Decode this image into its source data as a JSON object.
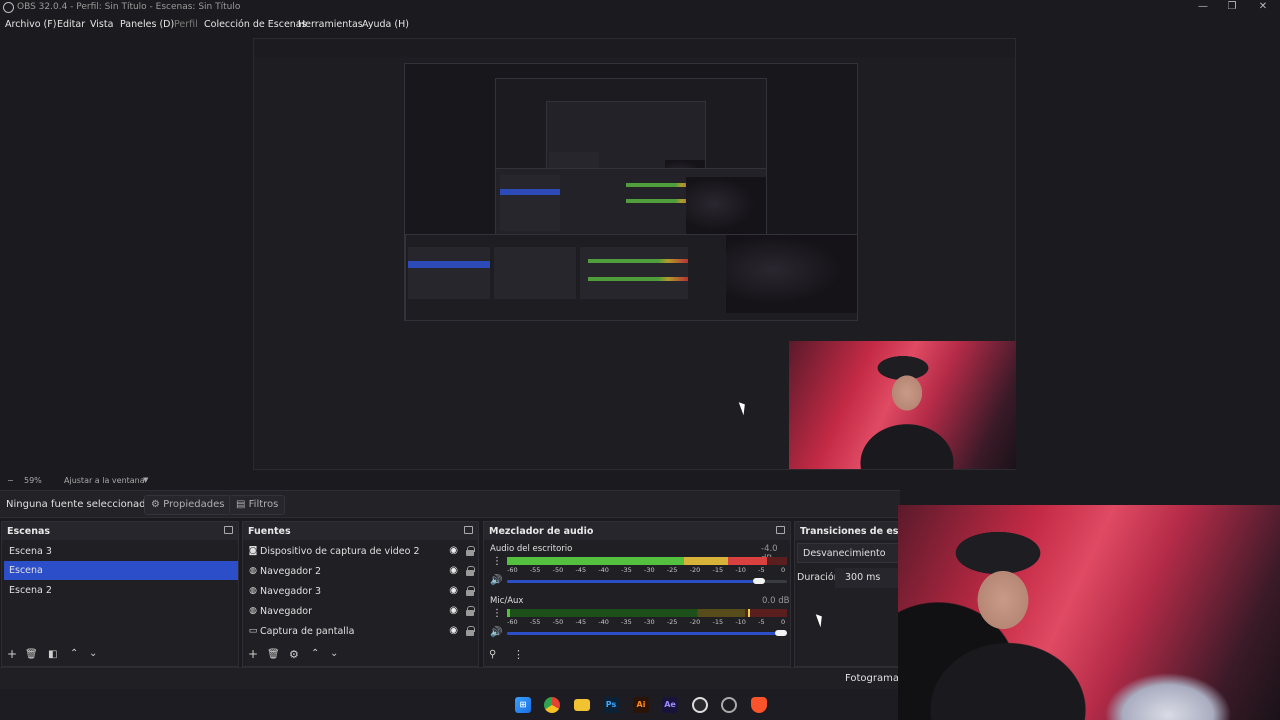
{
  "window": {
    "title": "OBS 32.0.4 - Perfil: Sin Título - Escenas: Sin Título",
    "controls": [
      "—",
      "❐",
      "✕"
    ]
  },
  "menu": [
    {
      "label": "Archivo (F)",
      "enabled": true
    },
    {
      "label": "Editar",
      "enabled": true
    },
    {
      "label": "Vista",
      "enabled": true
    },
    {
      "label": "Paneles (D)",
      "enabled": true
    },
    {
      "label": "Perfil",
      "enabled": false
    },
    {
      "label": "Colección de Escenas",
      "enabled": true
    },
    {
      "label": "Herramientas",
      "enabled": true
    },
    {
      "label": "Ayuda (H)",
      "enabled": true
    }
  ],
  "zoom": {
    "minus": "−",
    "level": "59%",
    "fit": "Ajustar a la ventana"
  },
  "source_bar": {
    "no_source": "Ninguna fuente seleccionad",
    "properties": "Propiedades",
    "filters": "Filtros"
  },
  "scenes": {
    "title": "Escenas",
    "items": [
      "Escena 3",
      "Escena",
      "Escena 2"
    ],
    "active_index": 1
  },
  "sources": {
    "title": "Fuentes",
    "items": [
      {
        "label": "Dispositivo de captura de video 2",
        "icon": "camera-icon"
      },
      {
        "label": "Navegador 2",
        "icon": "globe-icon"
      },
      {
        "label": "Navegador 3",
        "icon": "globe-icon"
      },
      {
        "label": "Navegador",
        "icon": "globe-icon"
      },
      {
        "label": "Captura de pantalla",
        "icon": "monitor-icon"
      }
    ]
  },
  "mixer": {
    "title": "Mezclador de audio",
    "ticks": [
      "-60",
      "-55",
      "-50",
      "-45",
      "-40",
      "-35",
      "-30",
      "-25",
      "-20",
      "-15",
      "-10",
      "-5",
      "0"
    ],
    "channels": [
      {
        "name": "Audio del escritorio",
        "db": "-4.0 dB",
        "level": 0.93,
        "volume": 0.88
      },
      {
        "name": "Mic/Aux",
        "db": "0.0 dB",
        "level": 0.01,
        "peak": 0.86,
        "volume": 1.0
      }
    ]
  },
  "transitions": {
    "title": "Transiciones de escena",
    "selected": "Desvanecimiento",
    "duration_label": "Duración",
    "duration": "300 ms"
  },
  "status": {
    "frames": "Fotogramas P"
  },
  "taskbar": [
    "windows-icon",
    "chrome-icon",
    "folder-icon",
    "Ps",
    "Ai",
    "Ae",
    "obs-icon",
    "steam-icon",
    "brave-icon"
  ],
  "colors": {
    "accent": "#2c4ec9",
    "background": "#1b1b1f",
    "panel": "#1f1f24"
  }
}
